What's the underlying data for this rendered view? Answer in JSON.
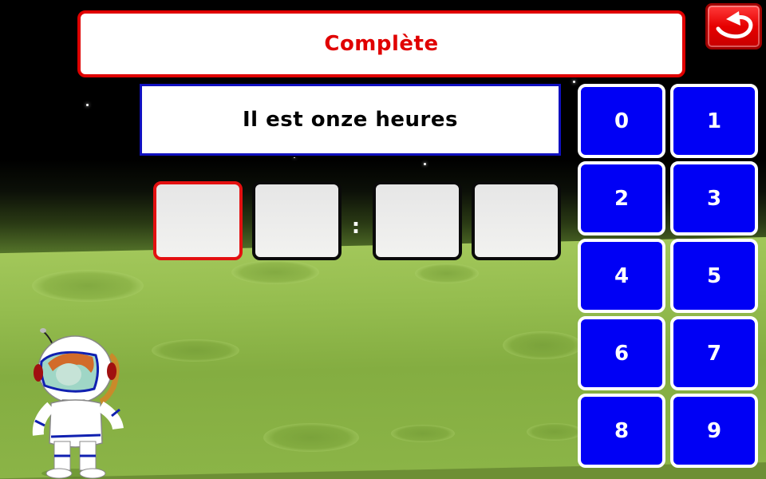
{
  "header": {
    "title": "Complète",
    "back_button_icon": "curved-back-arrow-icon"
  },
  "prompt": {
    "sentence": "Il est onze heures"
  },
  "time_input": {
    "separator": ":",
    "slots": [
      {
        "value": "",
        "active": true
      },
      {
        "value": "",
        "active": false
      },
      {
        "value": "",
        "active": false
      },
      {
        "value": "",
        "active": false
      }
    ]
  },
  "keypad": {
    "keys": [
      "0",
      "1",
      "2",
      "3",
      "4",
      "5",
      "6",
      "7",
      "8",
      "9"
    ]
  },
  "colors": {
    "title_red": "#e00000",
    "key_blue": "#0000f5",
    "sentence_border": "#1010c0",
    "ground_green": "#95bd4f"
  }
}
